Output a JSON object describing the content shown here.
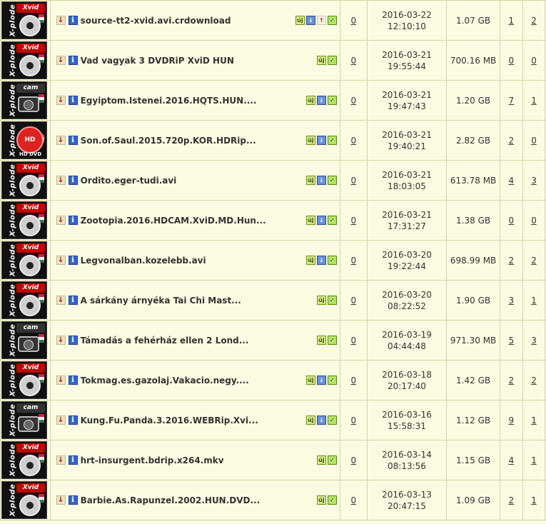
{
  "colors": {
    "row_bg": "#fbfbe2",
    "border": "#d3d3a5",
    "category_red": "#c40000"
  },
  "torrents": [
    {
      "category": "Xvid",
      "title": "source-tt2-xvid.avi.crdownload",
      "icons": [
        "uj",
        "down",
        "up",
        "ok"
      ],
      "comments": "0",
      "date": "2016-03-22",
      "time": "12:10:10",
      "size": "1.07 GB",
      "seeds": "1",
      "leeches": "2",
      "completed": "0"
    },
    {
      "category": "Xvid",
      "title": "Vad vagyak 3 DVDRiP XviD HUN",
      "icons": [
        "uj",
        "ok"
      ],
      "comments": "0",
      "date": "2016-03-21",
      "time": "19:55:44",
      "size": "700.16 MB",
      "seeds": "0",
      "leeches": "0",
      "completed": "0"
    },
    {
      "category": "cam",
      "title": "Egyiptom.Istenei.2016.HQTS.HUN....",
      "icons": [
        "uj",
        "down",
        "ok"
      ],
      "comments": "0",
      "date": "2016-03-21",
      "time": "19:47:43",
      "size": "1.20 GB",
      "seeds": "7",
      "leeches": "1",
      "completed": "0"
    },
    {
      "category": "HD",
      "title": "Son.of.Saul.2015.720p.KOR.HDRip...",
      "icons": [
        "uj",
        "down",
        "ok"
      ],
      "comments": "0",
      "date": "2016-03-21",
      "time": "19:40:21",
      "size": "2.82 GB",
      "seeds": "2",
      "leeches": "0",
      "completed": "0"
    },
    {
      "category": "Xvid",
      "title": "Ordito.eger-tudi.avi",
      "icons": [
        "uj",
        "down",
        "ok"
      ],
      "comments": "0",
      "date": "2016-03-21",
      "time": "18:03:05",
      "size": "613.78 MB",
      "seeds": "4",
      "leeches": "3",
      "completed": "0"
    },
    {
      "category": "Xvid",
      "title": "Zootopia.2016.HDCAM.XviD.MD.Hun...",
      "icons": [
        "uj",
        "down",
        "ok"
      ],
      "comments": "0",
      "date": "2016-03-21",
      "time": "17:31:27",
      "size": "1.38 GB",
      "seeds": "0",
      "leeches": "0",
      "completed": "0"
    },
    {
      "category": "Xvid",
      "title": "Legvonalban.kozelebb.avi",
      "icons": [
        "uj",
        "down",
        "ok"
      ],
      "comments": "0",
      "date": "2016-03-20",
      "time": "19:22:44",
      "size": "698.99 MB",
      "seeds": "2",
      "leeches": "2",
      "completed": "0"
    },
    {
      "category": "Xvid",
      "title": "A sárkány árnyéka Tai Chi Mast...",
      "icons": [
        "uj",
        "ok"
      ],
      "comments": "0",
      "date": "2016-03-20",
      "time": "08:22:52",
      "size": "1.90 GB",
      "seeds": "3",
      "leeches": "1",
      "completed": "0"
    },
    {
      "category": "cam",
      "title": "Támadás a fehérház ellen 2 Lond...",
      "icons": [
        "uj",
        "ok"
      ],
      "comments": "0",
      "date": "2016-03-19",
      "time": "04:44:48",
      "size": "971.30 MB",
      "seeds": "5",
      "leeches": "3",
      "completed": "0"
    },
    {
      "category": "Xvid",
      "title": "Tokmag.es.gazolaj.Vakacio.negy....",
      "icons": [
        "uj",
        "down",
        "ok"
      ],
      "comments": "0",
      "date": "2016-03-18",
      "time": "20:17:40",
      "size": "1.42 GB",
      "seeds": "2",
      "leeches": "2",
      "completed": "0"
    },
    {
      "category": "cam",
      "title": "Kung.Fu.Panda.3.2016.WEBRip.Xvi...",
      "icons": [
        "uj",
        "down",
        "ok"
      ],
      "comments": "0",
      "date": "2016-03-16",
      "time": "15:58:31",
      "size": "1.12 GB",
      "seeds": "9",
      "leeches": "1",
      "completed": "0"
    },
    {
      "category": "Xvid",
      "title": "hrt-insurgent.bdrip.x264.mkv",
      "icons": [
        "uj",
        "ok"
      ],
      "comments": "0",
      "date": "2016-03-14",
      "time": "08:13:56",
      "size": "1.15 GB",
      "seeds": "4",
      "leeches": "1",
      "completed": "0"
    },
    {
      "category": "Xvid",
      "title": "Barbie.As.Rapunzel.2002.HUN.DVD...",
      "icons": [
        "uj",
        "ok"
      ],
      "comments": "0",
      "date": "2016-03-13",
      "time": "20:47:15",
      "size": "1.09 GB",
      "seeds": "2",
      "leeches": "1",
      "completed": "0"
    }
  ],
  "brand_label": "X-plode",
  "hd_sub": "HD DVD"
}
